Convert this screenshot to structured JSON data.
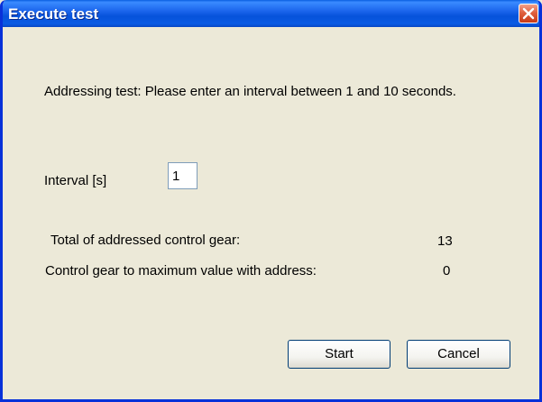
{
  "window": {
    "title": "Execute test",
    "close_label": "Close"
  },
  "message": "Addressing test: Please enter an interval between 1 and 10 seconds.",
  "interval": {
    "label": "Interval [s]",
    "value": "1"
  },
  "stats": {
    "total_label": "Total of addressed control gear:",
    "total_value": "13",
    "max_label": "Control gear to maximum value with address:",
    "max_value": "0"
  },
  "buttons": {
    "start": "Start",
    "cancel": "Cancel"
  },
  "colors": {
    "titlebar": "#0a5be4",
    "close": "#e0613f",
    "face": "#ece9d8"
  }
}
